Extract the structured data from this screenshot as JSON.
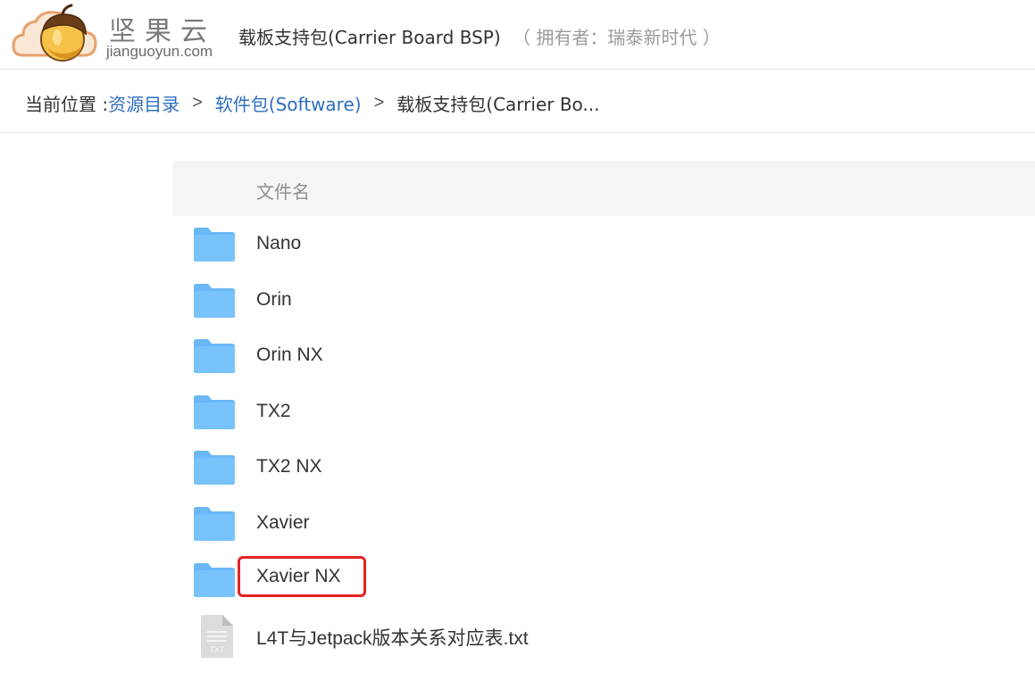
{
  "header": {
    "logo_cn": "坚果云",
    "logo_en": "jianguoyun.com",
    "title": "载板支持包(Carrier Board BSP)",
    "owner": "（ 拥有者：瑞泰新时代 ）"
  },
  "breadcrumb": {
    "prefix": "当前位置 : ",
    "items": [
      {
        "label": "资源目录"
      },
      {
        "label": "软件包(Software)"
      }
    ],
    "separator": ">",
    "current": "载板支持包(Carrier Bo..."
  },
  "table": {
    "column_name": "文件名",
    "rows": [
      {
        "name": "Nano",
        "type": "folder"
      },
      {
        "name": "Orin",
        "type": "folder"
      },
      {
        "name": "Orin NX",
        "type": "folder"
      },
      {
        "name": "TX2",
        "type": "folder"
      },
      {
        "name": "TX2 NX",
        "type": "folder"
      },
      {
        "name": "Xavier",
        "type": "folder"
      },
      {
        "name": "Xavier NX",
        "type": "folder",
        "highlighted": true
      },
      {
        "name": "L4T与Jetpack版本关系对应表.txt",
        "type": "txt-file",
        "icon_label": "TXT"
      }
    ]
  },
  "colors": {
    "folder": "#78c3fb",
    "folder_tab": "#6ab8f5",
    "link": "#2e6fbf",
    "highlight_box": "#e52222",
    "header_bg": "#f5f5f5"
  }
}
